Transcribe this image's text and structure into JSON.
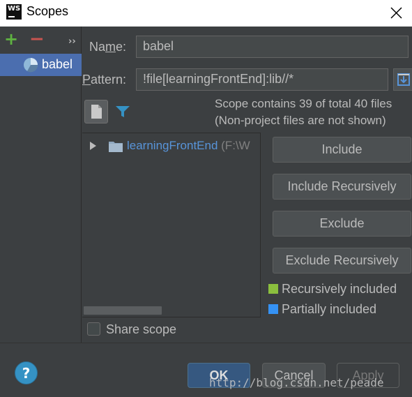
{
  "window": {
    "title": "Scopes",
    "logo_text": "WS"
  },
  "left_toolbar": {
    "add_icon": "plus-icon",
    "remove_icon": "minus-icon",
    "more_icon": "double-chevron-right-icon"
  },
  "scopes": [
    {
      "label": "babel",
      "icon": "scope-pie-icon"
    }
  ],
  "form": {
    "name_label_pre": "Na",
    "name_label_ul": "m",
    "name_label_post": "e:",
    "name_value": "babel",
    "pattern_label_ul": "P",
    "pattern_label_post": "attern:",
    "pattern_value": "!file[learningFrontEnd]:lib//*"
  },
  "info": {
    "line1": "Scope contains 39 of total 40 files",
    "line2": "(Non-project files are not shown)"
  },
  "tree": {
    "node_name": "learningFrontEnd",
    "node_path": " (F:\\W"
  },
  "actions": {
    "include": "Include",
    "include_recursively": "Include Recursively",
    "exclude": "Exclude",
    "exclude_recursively": "Exclude Recursively"
  },
  "legend": {
    "recursive_label": "Recursively included",
    "recursive_color": "#8bbf3e",
    "partial_label": "Partially included",
    "partial_color": "#3592f4"
  },
  "share_scope": {
    "label": "Share scope",
    "checked": false
  },
  "dialog_buttons": {
    "ok": "OK",
    "cancel": "Cancel",
    "apply": "Apply",
    "help": "?"
  },
  "watermark": "http://blog.csdn.net/peade"
}
